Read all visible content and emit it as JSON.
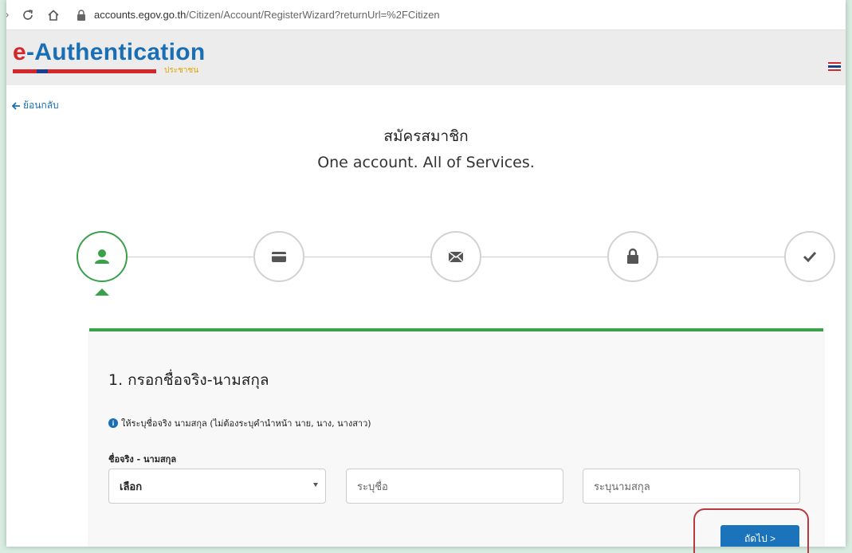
{
  "browser": {
    "url_domain": "accounts.egov.go.th",
    "url_path": "/Citizen/Account/RegisterWizard?returnUrl=%2FCitizen"
  },
  "header": {
    "logo_e": "e",
    "logo_rest": "-Authentication",
    "logo_sub": "ประชาชน"
  },
  "nav": {
    "back_label": "ย้อนกลับ"
  },
  "page": {
    "title_th": "สมัครสมาชิก",
    "title_en": "One account. All of Services."
  },
  "stepper": {
    "steps": [
      {
        "icon": "user-icon",
        "active": true
      },
      {
        "icon": "card-icon",
        "active": false
      },
      {
        "icon": "envelope-icon",
        "active": false
      },
      {
        "icon": "lock-icon",
        "active": false
      },
      {
        "icon": "check-icon",
        "active": false
      }
    ],
    "accent": "#3aa04a"
  },
  "form": {
    "heading": "1. กรอกชื่อจริง-นามสกุล",
    "info_text": "ให้ระบุชื่อจริง นามสกุล (ไม่ต้องระบุคำนำหน้า นาย, นาง, นางสาว)",
    "name_label": "ชื่อจริง - นามสกุล",
    "title_select_value": "เลือก",
    "first_name_placeholder": "ระบุชื่อ",
    "last_name_placeholder": "ระบุนามสกุล",
    "next_label": "ถัดไป >"
  },
  "colors": {
    "brand_blue": "#1a6fb4",
    "brand_red": "#d7262b",
    "button_blue": "#1b74bb",
    "highlight": "#b8393e"
  }
}
